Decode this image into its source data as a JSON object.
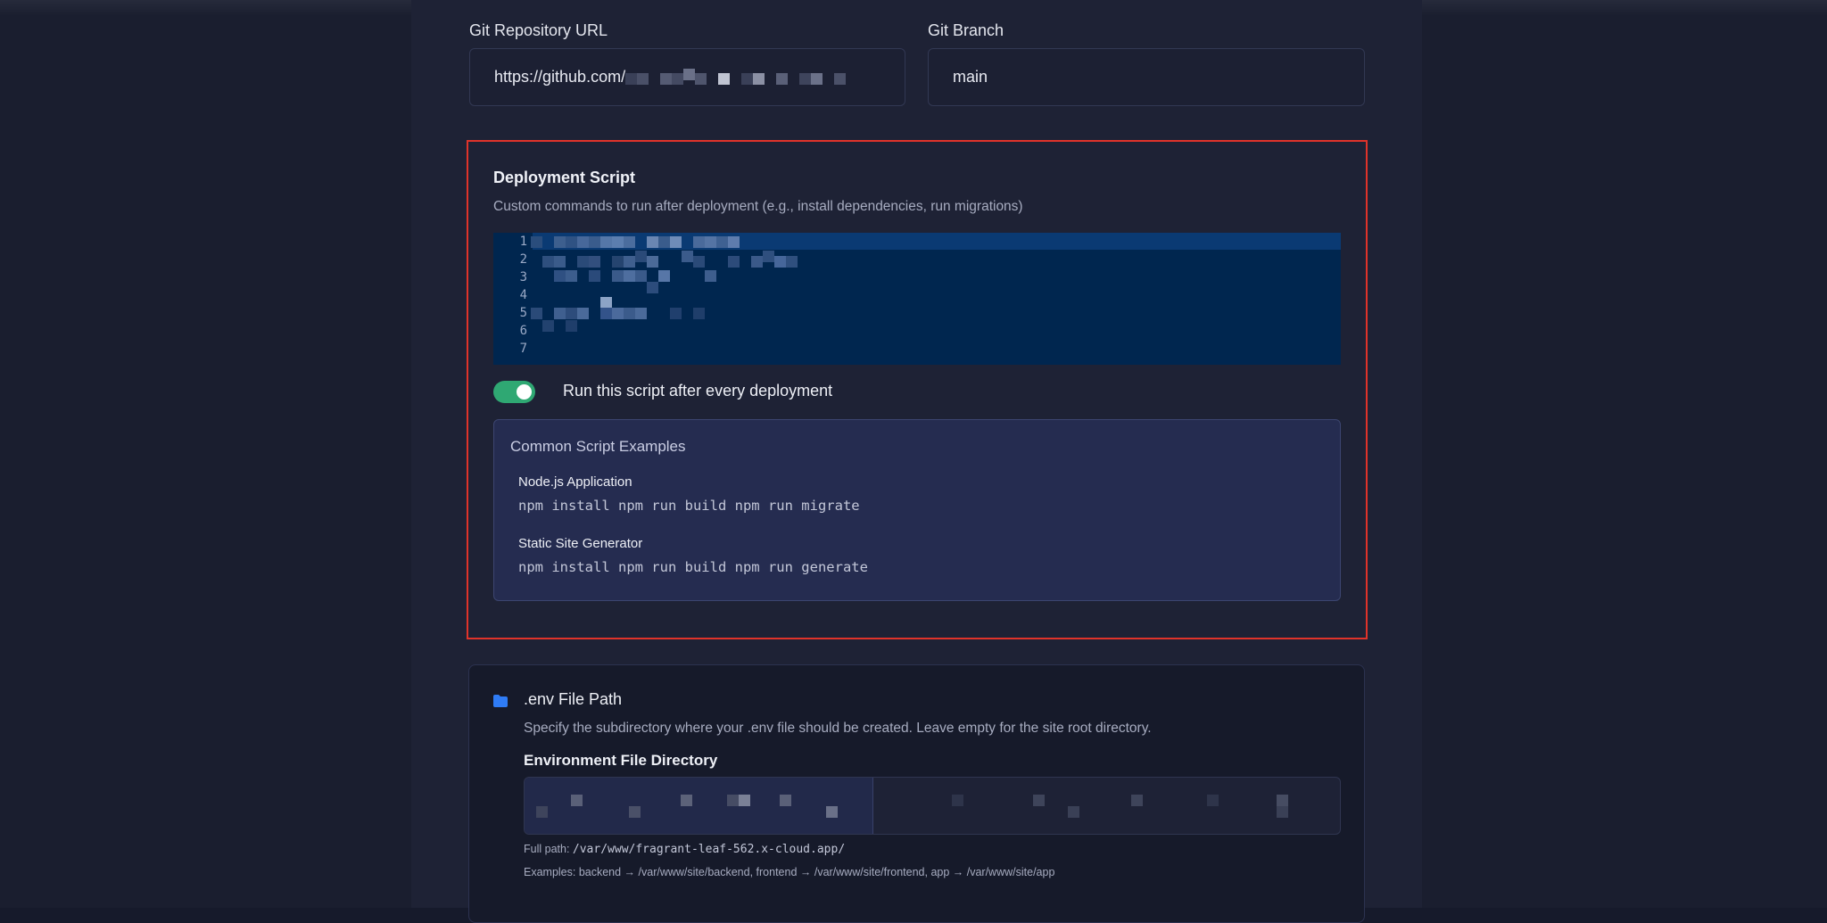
{
  "repo": {
    "url_label": "Git Repository URL",
    "url_value": "https://github.com/",
    "branch_label": "Git Branch",
    "branch_value": "main"
  },
  "deploy": {
    "title": "Deployment Script",
    "description": "Custom commands to run after deployment (e.g., install dependencies, run migrations)",
    "line_numbers": [
      "1",
      "2",
      "3",
      "4",
      "5",
      "6",
      "7"
    ],
    "toggle_label": "Run this script after every deployment",
    "toggle_on": true,
    "examples_title": "Common Script Examples",
    "examples": [
      {
        "name": "Node.js Application",
        "code": "npm install npm run build npm run migrate"
      },
      {
        "name": "Static Site Generator",
        "code": "npm install npm run build npm run generate"
      }
    ]
  },
  "env": {
    "title": ".env File Path",
    "description": "Specify the subdirectory where your .env file should be created. Leave empty for the site root directory.",
    "dir_label": "Environment File Directory",
    "fullpath_label": "Full path:",
    "fullpath_value": "/var/www/fragrant-leaf-562.x-cloud.app/",
    "examples_text": "Examples: backend → /var/www/site/backend, frontend → /var/www/site/frontend, app → /var/www/site/app"
  },
  "colors": {
    "accent_red": "#e0332a",
    "toggle_green": "#2fa873",
    "editor_bg": "#00264f",
    "folder_blue": "#2f7cf6"
  }
}
